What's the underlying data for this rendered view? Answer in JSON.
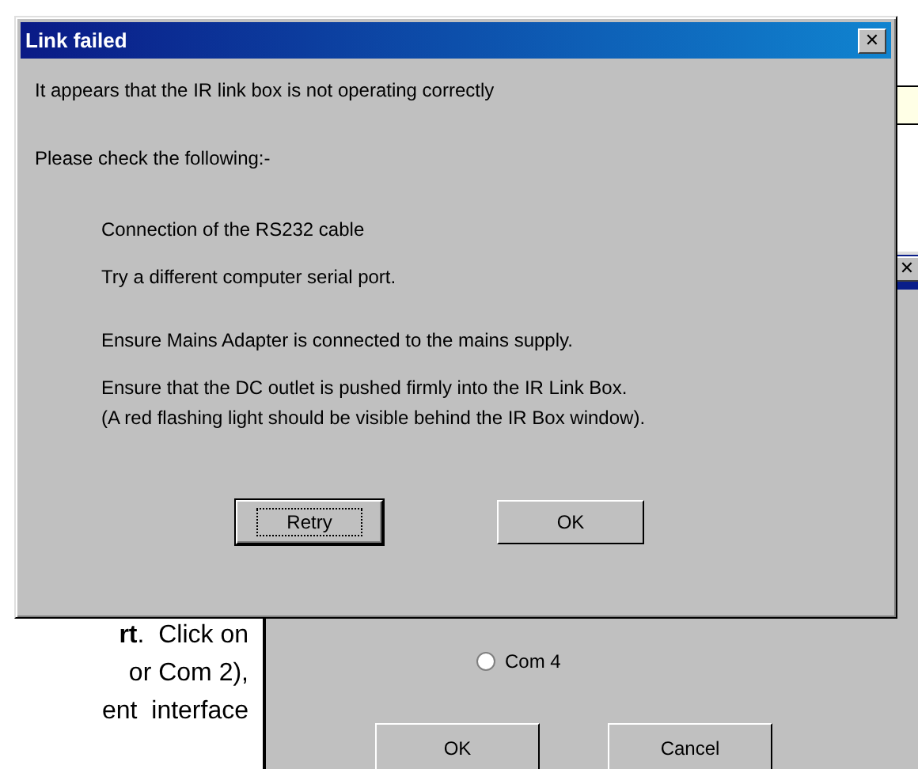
{
  "document": {
    "lines": [
      "**rt**.  Click on",
      "or Com 2),",
      "ent  interface"
    ]
  },
  "back_dialog": {
    "close_icon": "✕",
    "radio": {
      "label": "Com 4",
      "selected": false
    },
    "buttons": [
      {
        "label": "OK"
      },
      {
        "label": "Cancel"
      }
    ]
  },
  "dialog": {
    "title": "Link failed",
    "close_icon": "✕",
    "paragraphs": [
      {
        "kind": "plain",
        "text": "It appears that the IR link box is not operating correctly"
      },
      {
        "kind": "plain",
        "text": "Please check the following:-"
      },
      {
        "kind": "item",
        "text": "Connection of the RS232 cable"
      },
      {
        "kind": "item",
        "text": "Try a different computer serial port."
      },
      {
        "kind": "item",
        "text": "Ensure Mains Adapter is connected to the mains supply."
      },
      {
        "kind": "item",
        "text": "Ensure that the DC outlet is pushed firmly into the IR Link Box."
      },
      {
        "kind": "item_tight",
        "text": "(A red flashing light should be visible behind the IR Box window)."
      }
    ],
    "buttons": [
      {
        "label": "Retry",
        "focused": true
      },
      {
        "label": "OK",
        "focused": false
      }
    ]
  }
}
